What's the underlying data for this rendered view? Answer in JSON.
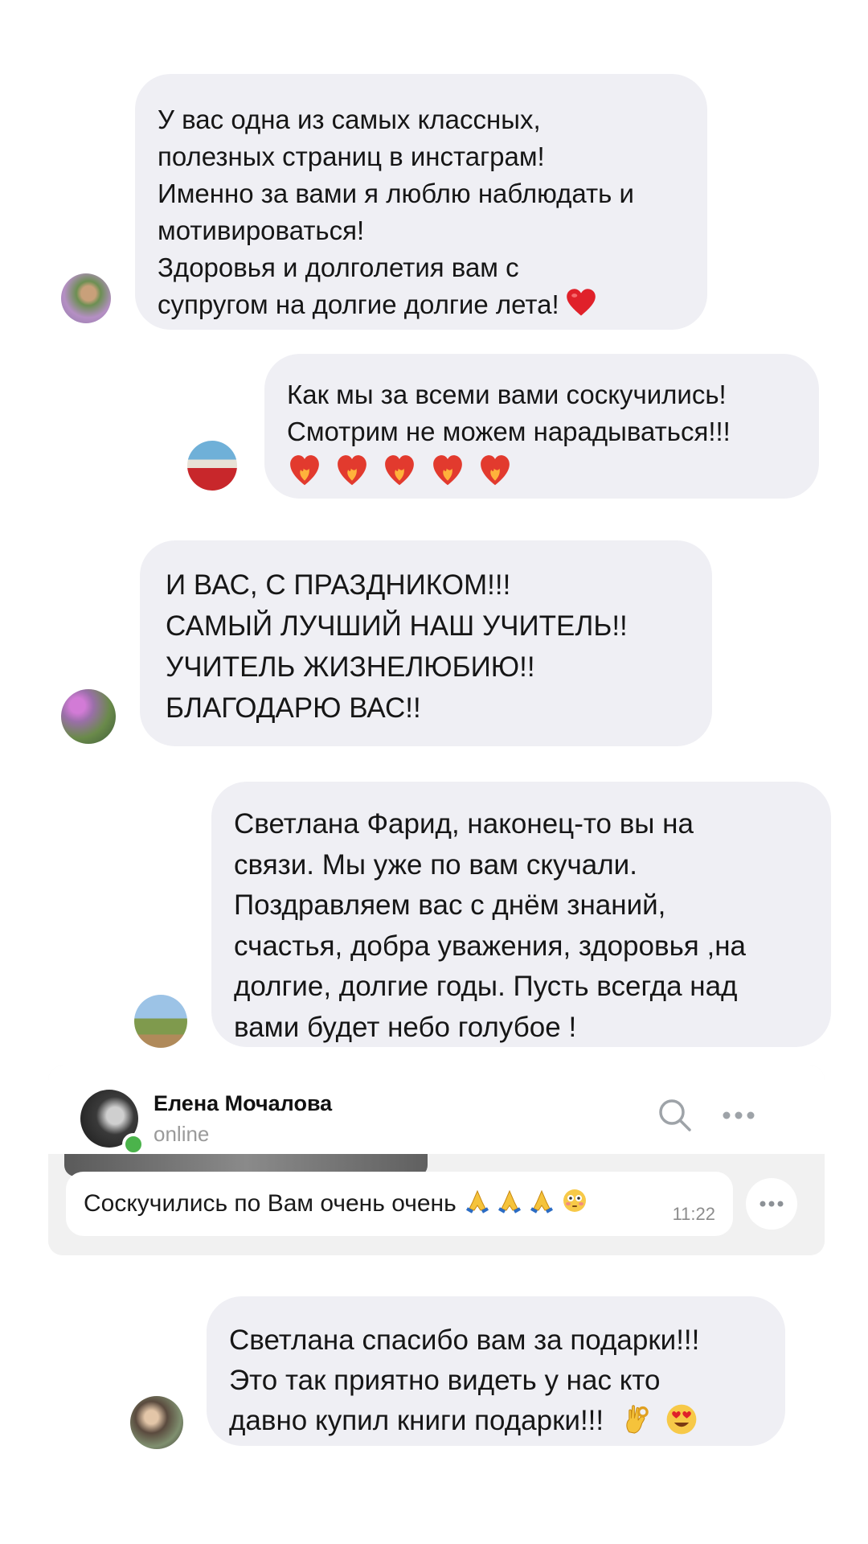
{
  "messages": [
    {
      "lines": [
        "У вас одна из самых классных,",
        "полезных страниц в инстаграм!",
        "Именно за вами я люблю наблюдать и",
        "мотивироваться!",
        "Здоровья и долголетия вам с",
        "супругом на долгие долгие лета!"
      ],
      "emoji": "red-heart"
    },
    {
      "lines": [
        "Как мы за всеми вами соскучились!",
        "Смотрим не можем нарадываться!!!"
      ],
      "emoji": "heart-on-fire x5"
    },
    {
      "lines": [
        "И ВАС, С ПРАЗДНИКОМ!!!",
        "САМЫЙ ЛУЧШИЙ НАШ УЧИТЕЛЬ!!",
        "УЧИТЕЛЬ ЖИЗНЕЛЮБИЮ!!",
        "БЛАГОДАРЮ ВАС!!"
      ]
    },
    {
      "lines": [
        "Светлана  Фарид, наконец-то  вы на",
        "связи. Мы уже по вам скучали.",
        "Поздравляем вас с днём знаний,",
        "счастья, добра уважения, здоровья ,на",
        "долгие, долгие годы. Пусть всегда над",
        "вами будет небо голубое !"
      ]
    },
    {
      "lines": [
        "Светлана спасибо вам за подарки!!!",
        "Это так приятно видеть у нас кто",
        "давно купил книги подарки!!!"
      ],
      "emoji": "ok-hand, heart-eyes"
    }
  ],
  "chat_card": {
    "contact_name": "Елена Мочалова",
    "status": "online",
    "message": "Соскучились по Вам очень очень",
    "message_emoji": "folded-hands x3, flushed-face",
    "time": "11:22",
    "icons": [
      "search-icon",
      "more-icon"
    ]
  },
  "colors": {
    "bubble_bg": "#efeff4",
    "card_bg": "#f1f1f1",
    "online_dot": "#4bb34b",
    "heart": "#e0212a"
  }
}
